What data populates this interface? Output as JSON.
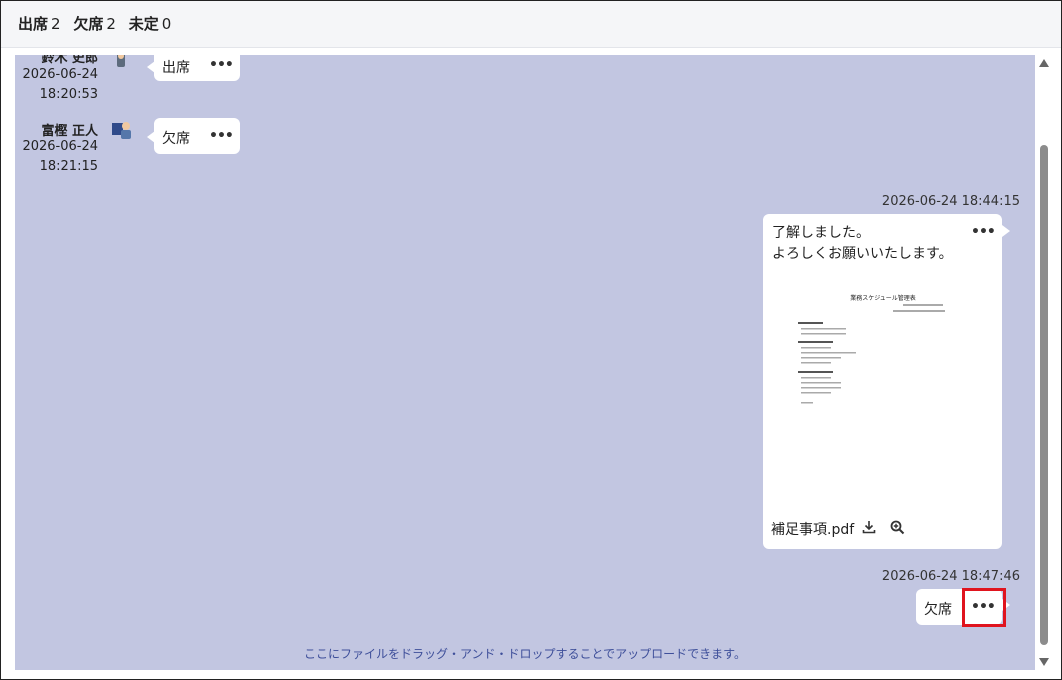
{
  "summary": {
    "attend_label": "出席",
    "attend_count": "2",
    "absent_label": "欠席",
    "absent_count": "2",
    "undecided_label": "未定",
    "undecided_count": "0"
  },
  "messages": [
    {
      "name": "鈴木 史郎",
      "date": "2026-06-24",
      "time": "18:20:53",
      "text": "出席",
      "avatar": "person-avatar-icon"
    },
    {
      "name": "富樫 正人",
      "date": "2026-06-24",
      "time": "18:21:15",
      "text": "欠席",
      "avatar": "person-with-computer-avatar-icon"
    }
  ],
  "own_messages": [
    {
      "timestamp": "2026-06-24 18:44:15",
      "line1": "了解しました。",
      "line2": "よろしくお願いいたします。",
      "attachment": {
        "filename": "補足事項.pdf",
        "doc_title": "業務スケジュール管理表"
      }
    },
    {
      "timestamp": "2026-06-24 18:47:46",
      "text": "欠席"
    }
  ],
  "drop_hint": "ここにファイルをドラッグ・アンド・ドロップすることでアップロードできます。",
  "more_label": "•••",
  "colors": {
    "chat_bg": "#c2c6e1",
    "highlight": "#e0141e"
  }
}
